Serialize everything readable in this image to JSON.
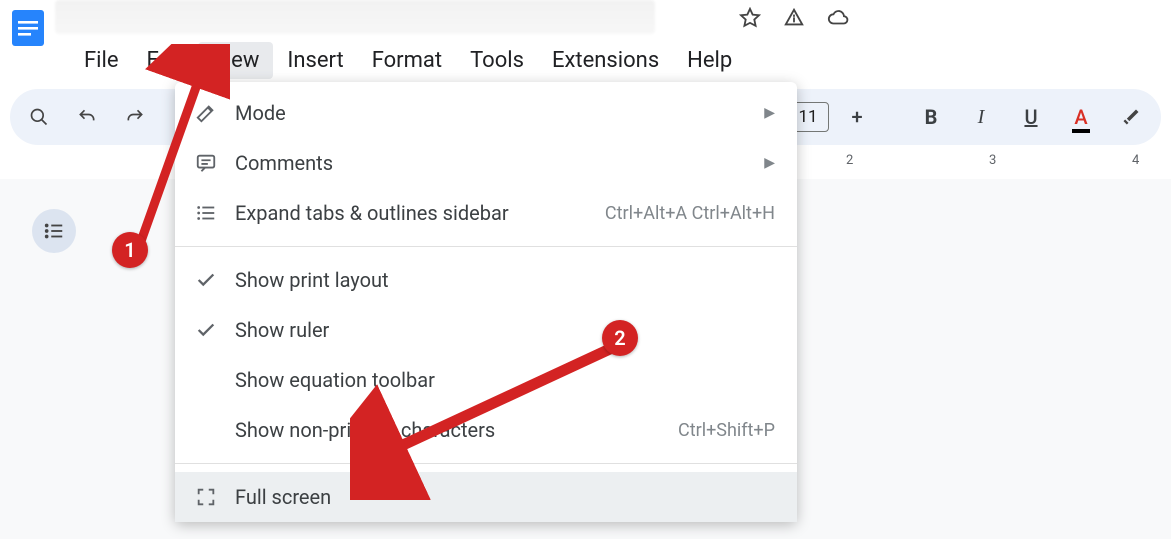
{
  "menubar": {
    "items": [
      "File",
      "Edit",
      "View",
      "Insert",
      "Format",
      "Tools",
      "Extensions",
      "Help"
    ],
    "active_index": 2
  },
  "toolbar": {
    "font_size": "11"
  },
  "ruler": {
    "marks": [
      {
        "label": "2",
        "pos": 846
      },
      {
        "label": "3",
        "pos": 989
      },
      {
        "label": "4",
        "pos": 1132
      }
    ]
  },
  "dropdown": {
    "items": [
      {
        "icon": "mode",
        "label": "Mode",
        "submenu": true
      },
      {
        "icon": "comments",
        "label": "Comments",
        "submenu": true
      },
      {
        "icon": "expand",
        "label": "Expand tabs & outlines sidebar",
        "shortcut": "Ctrl+Alt+A Ctrl+Alt+H"
      },
      {
        "sep": true
      },
      {
        "icon": "check",
        "label": "Show print layout"
      },
      {
        "icon": "check",
        "label": "Show ruler"
      },
      {
        "icon": "",
        "label": "Show equation toolbar"
      },
      {
        "icon": "",
        "label": "Show non-printing characters",
        "shortcut": "Ctrl+Shift+P"
      },
      {
        "sep": true
      },
      {
        "icon": "fullscreen",
        "label": "Full screen",
        "highlight": true
      }
    ]
  },
  "annotations": {
    "c1": "1",
    "c2": "2"
  }
}
